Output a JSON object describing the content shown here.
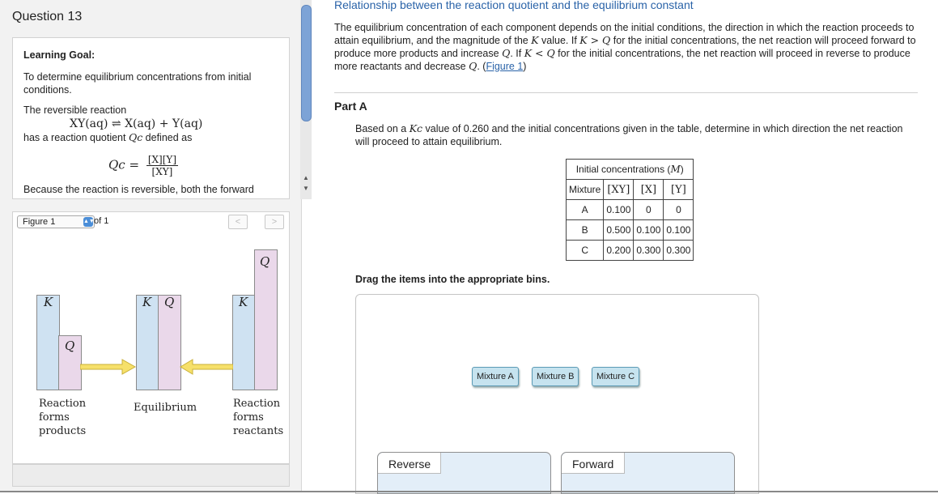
{
  "question": {
    "title": "Question 13"
  },
  "learning_goal": {
    "heading": "Learning Goal:",
    "goal": "To determine equilibrium concentrations from initial conditions.",
    "reversible_text": "The reversible reaction",
    "reaction": "XY(aq) ⇌ X(aq) + Y(aq)",
    "qc_text_prefix": "has a reaction quotient ",
    "qc_symbol": "Qc",
    "qc_text_suffix": " defined as",
    "qc_lhs": "Qc =",
    "qc_numerator": "[X][Y]",
    "qc_denominator": "[XY]",
    "because_text": "Because the reaction is reversible, both the forward"
  },
  "figure_nav": {
    "selected": "Figure 1",
    "of_text": "of 1",
    "prev": "<",
    "next": ">"
  },
  "figure": {
    "k_label": "K",
    "q_label": "Q",
    "captions": {
      "left": [
        "Reaction",
        "forms",
        "products"
      ],
      "middle": "Equilibrium",
      "right": [
        "Reaction",
        "forms",
        "reactants"
      ]
    }
  },
  "main": {
    "title": "Relationship between the reaction quotient and the equilibrium constant",
    "intro_1": "The equilibrium concentration of each component depends on the initial conditions, the direction in which the reaction proceeds to attain equilibrium, and the magnitude of the ",
    "intro_2": " value. If ",
    "intro_3": " for the initial concentrations, the net reaction will proceed forward to produce more products and increase ",
    "intro_4": ". If ",
    "intro_5": " for the initial concentrations, the net reaction will proceed in reverse to produce more reactants and decrease ",
    "intro_6": ". (",
    "intro_link": "Figure 1",
    "intro_7": ")",
    "k": "K",
    "q": "Q",
    "k_gt_q": "K > Q",
    "k_lt_q": "K < Q",
    "part_label": "Part A",
    "prompt_1": "Based on a ",
    "prompt_kc": "Kc",
    "prompt_2": " value of 0.260 and the initial concentrations given in the table, determine in which direction the net reaction will proceed to attain equilibrium.",
    "table": {
      "caption_text": "Initial concentrations (",
      "caption_unit": "M",
      "caption_close": ")",
      "col_mixture": "Mixture",
      "col_xy": "[XY]",
      "col_x": "[X]",
      "col_y": "[Y]",
      "rows": [
        {
          "mixture": "A",
          "xy": "0.100",
          "x": "0",
          "y": "0"
        },
        {
          "mixture": "B",
          "xy": "0.500",
          "x": "0.100",
          "y": "0.100"
        },
        {
          "mixture": "C",
          "xy": "0.200",
          "x": "0.300",
          "y": "0.300"
        }
      ]
    },
    "drag_instruction": "Drag the items into the appropriate bins.",
    "items": [
      "Mixture A",
      "Mixture B",
      "Mixture C"
    ],
    "bins": [
      "Reverse",
      "Forward"
    ]
  }
}
